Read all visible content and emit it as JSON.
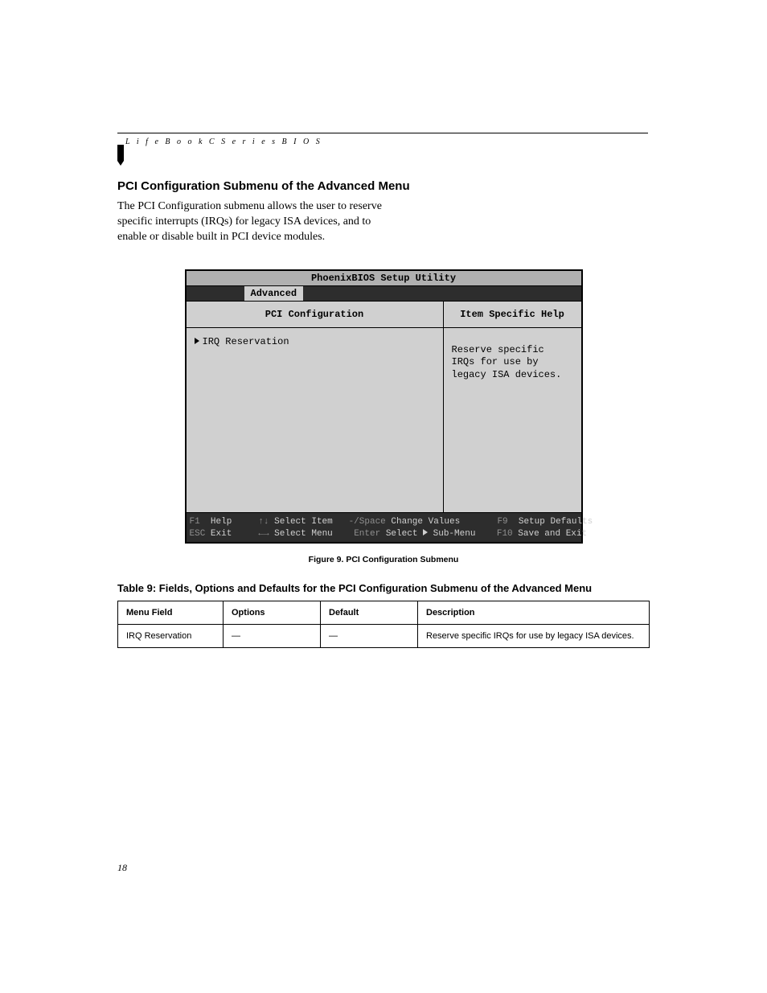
{
  "header": {
    "running": "L i f e B o o k   C   S e r i e s   B I O S"
  },
  "section": {
    "title": "PCI Configuration Submenu of the Advanced Menu",
    "intro": "The PCI Configuration submenu allows the user to reserve specific interrupts (IRQs) for legacy ISA devices, and to enable or disable built in PCI device modules."
  },
  "bios": {
    "title": "PhoenixBIOS Setup Utility",
    "tab": "Advanced",
    "left_header": "PCI Configuration",
    "right_header": "Item Specific Help",
    "submenu_item": "IRQ Reservation",
    "help_text": "Reserve specific IRQs for use by legacy ISA devices.",
    "footer": {
      "f1": "F1",
      "help": "Help",
      "updown": "↑↓",
      "select_item": "Select Item",
      "minus_space": "-/Space",
      "change_values": "Change Values",
      "f9": "F9",
      "setup_defaults": "Setup Defaults",
      "esc": "ESC",
      "exit": "Exit",
      "leftright": "←→",
      "select_menu": "Select Menu",
      "enter": "Enter",
      "select_submenu": "Select    Sub-Menu",
      "f10": "F10",
      "save_exit": "Save and Exit"
    }
  },
  "figure_caption": "Figure 9.  PCI Configuration Submenu",
  "table": {
    "title": "Table 9: Fields, Options and Defaults for  the PCI Configuration Submenu of the Advanced Menu",
    "headers": [
      "Menu Field",
      "Options",
      "Default",
      "Description"
    ],
    "rows": [
      {
        "field": "IRQ Reservation",
        "options": "—",
        "default": "—",
        "description": "Reserve specific IRQs for use by legacy ISA devices."
      }
    ]
  },
  "page_number": "18"
}
